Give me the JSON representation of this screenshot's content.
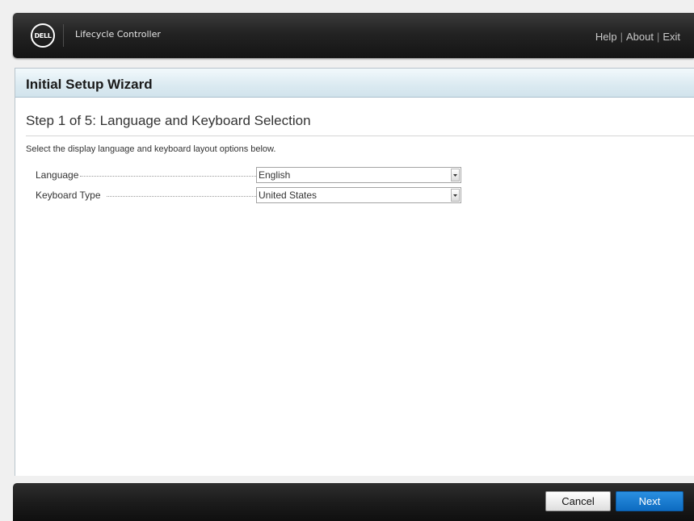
{
  "header": {
    "logo_text": "DELL",
    "app_title": "Lifecycle Controller",
    "links": {
      "help": "Help",
      "about": "About",
      "exit": "Exit",
      "separator": "|"
    }
  },
  "wizard": {
    "title": "Initial Setup Wizard",
    "step_title": "Step 1 of 5: Language and Keyboard Selection",
    "instructions": "Select the display language and keyboard layout options below.",
    "fields": {
      "language": {
        "label": "Language",
        "selected": "English",
        "icon": "chevron-down-icon"
      },
      "keyboard_type": {
        "label": "Keyboard Type",
        "selected": "United States",
        "icon": "chevron-down-icon"
      }
    }
  },
  "footer": {
    "cancel_label": "Cancel",
    "next_label": "Next"
  },
  "colors": {
    "header_bg": "#232323",
    "wizard_header_bg": "#dbeaf1",
    "next_button": "#1a7ed4",
    "page_bg": "#f0f0f0"
  }
}
